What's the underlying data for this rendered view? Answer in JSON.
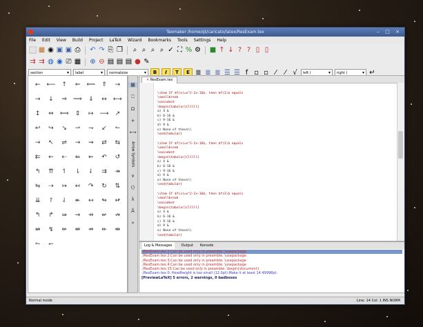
{
  "window": {
    "title": "Texmaker /home/qt/caricato/latex/ResExam.tex"
  },
  "menu": [
    "File",
    "Edit",
    "View",
    "Build",
    "Project",
    "LaTeX",
    "Wizard",
    "Bookmarks",
    "Tools",
    "Settings",
    "Help"
  ],
  "toolbar3": {
    "section": "section",
    "label": "label",
    "size": "normalsize",
    "left": "left (",
    "right": "right )"
  },
  "editor": {
    "tab": "ResExam.tex",
    "lines": [
      "",
      "\\item If $f(x)=x^2-2x-16$, then $f(3)$ equals",
      "\\smallbreak",
      "\\noindent",
      "\\begin{tabular}{lllll}",
      "a) 4 &",
      "b) 6-16 &",
      "c) 9-16 &",
      "d) 9 &",
      "e) None of these\\\\",
      "\\end{tabular}",
      "",
      "\\item If $f(x)=x^2-2x-16$, then $f(3)$ equals",
      "\\smallbreak",
      "\\noindent",
      "\\begin{tabular}{lllll}",
      "a) 4 &",
      "b) 6-16 &",
      "c) 9-16 &",
      "d) 9 &",
      "e) None of these\\\\",
      "\\end{tabular}",
      "",
      "\\item If $f(x)=x^2-2x-16$, then $f(3)$ equals",
      "\\smallbreak",
      "\\noindent",
      "\\begin{tabular}{lllll}",
      "a) 4 &",
      "b) 6-16 &",
      "c) 9-16 &",
      "d) 9 &",
      "e) None of these\\\\",
      "\\end{tabular}"
    ]
  },
  "bottom": {
    "tabs": [
      "Log & Messages",
      "Output",
      "Konsole"
    ],
    "log": [
      "./ResExam.tex:1:Can be used only in preamble. \\usepackage",
      "./ResExam.tex:2:Can be used only in preamble. \\usepackage",
      "./ResExam.tex:3:Can be used only in preamble. \\usepackage",
      "./ResExam.tex:4:Can be used only in preamble. \\usepackage",
      "./ResExam.tex:15:Can be used only in preamble. \\begin{document}",
      "./ResExam.tex:0: Headheight is too small (12.0pt):Make it at least 14.49998pt.",
      "[PreviewLaTeX] 5 errors, 2 warnings, 0 badboxes"
    ]
  },
  "status": {
    "mode": "Normal mode",
    "pos": "Line: 14 Col: 1  INS  NORM"
  },
  "vtab_label": "Arrow Symbols",
  "symbols": [
    "←",
    "⟵",
    "↑",
    "⇐",
    "⟸",
    "⇑",
    "→",
    "→",
    "↓",
    "⇒",
    "⟹",
    "⇓",
    "↔",
    "⟷",
    "↕",
    "⇔",
    "⟺",
    "⇕",
    "↦",
    "⟶",
    "↗",
    "↩",
    "↪",
    "↘",
    "⇀",
    "⇁",
    "↙",
    "↼",
    "→",
    "↖",
    "⇌",
    "→",
    "⇝",
    "⇄",
    "⇆",
    "⇇",
    "←",
    "⇠",
    "⇚",
    "⇜",
    "↶",
    "↺",
    "↰",
    "⇈",
    "↿",
    "⇂",
    "⇃",
    "⇉",
    "↠",
    "⇋",
    "⇢",
    "↣",
    "↢",
    "↷",
    "↻",
    "⇅",
    "⇊",
    "↾",
    "⇃",
    "↞",
    "↤",
    "↬",
    "↫",
    "↰",
    "↱",
    "⇛",
    "⇝",
    "⇸",
    "↚",
    "↛",
    "↮",
    "↯",
    "⇍",
    "⇎",
    "⇏",
    "⇷",
    "⇹",
    "↼",
    "↽"
  ]
}
